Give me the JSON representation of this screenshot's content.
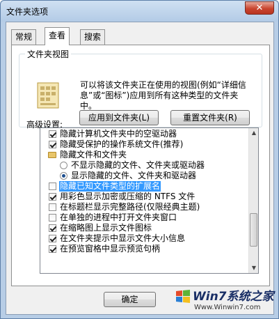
{
  "window": {
    "title": "文件夹选项",
    "close_glyph": "✕"
  },
  "tabs": [
    {
      "label": "常规",
      "active": false
    },
    {
      "label": "查看",
      "active": true
    },
    {
      "label": "搜索",
      "active": false
    }
  ],
  "folder_views": {
    "legend": "文件夹视图",
    "description": "可以将该文件夹正在使用的视图(例如“详细信息”或“图标”)应用到所有这种类型的文件夹中。",
    "apply_button": "应用到文件夹(L)",
    "reset_button": "重置文件夹(R)",
    "icon": "folder-view-icon"
  },
  "advanced": {
    "label": "高级设置:",
    "items": [
      {
        "type": "checkbox",
        "checked": true,
        "label": "隐藏计算机文件夹中的空驱动器",
        "indent": 0
      },
      {
        "type": "checkbox",
        "checked": true,
        "label": "隐藏受保护的操作系统文件(推荐)",
        "indent": 0
      },
      {
        "type": "folder",
        "checked": false,
        "label": "隐藏文件和文件夹",
        "indent": 0
      },
      {
        "type": "radio",
        "checked": false,
        "label": "不显示隐藏的文件、文件夹或驱动器",
        "indent": 1
      },
      {
        "type": "radio",
        "checked": true,
        "label": "显示隐藏的文件、文件夹和驱动器",
        "indent": 1
      },
      {
        "type": "checkbox",
        "checked": false,
        "label": "隐藏已知文件类型的扩展名",
        "indent": 0,
        "highlight": true
      },
      {
        "type": "checkbox",
        "checked": true,
        "label": "用彩色显示加密或压缩的 NTFS 文件",
        "indent": 0
      },
      {
        "type": "checkbox",
        "checked": false,
        "label": "在标题栏显示完整路径(仅限经典主题)",
        "indent": 0
      },
      {
        "type": "checkbox",
        "checked": false,
        "label": "在单独的进程中打开文件夹窗口",
        "indent": 0
      },
      {
        "type": "checkbox",
        "checked": true,
        "label": "在缩略图上显示文件图标",
        "indent": 0
      },
      {
        "type": "checkbox",
        "checked": true,
        "label": "在文件夹提示中显示文件大小信息",
        "indent": 0
      },
      {
        "type": "checkbox",
        "checked": true,
        "label": "在预览窗格中显示预览句柄",
        "indent": 0
      }
    ]
  },
  "footer": {
    "ok_button": "确定"
  },
  "watermark": {
    "title": "Win7系统之家",
    "url": "Www.Winwin7.com"
  },
  "colors": {
    "selection": "#3399ff",
    "title_bar": "#b7cde6",
    "close": "#c9452f"
  }
}
